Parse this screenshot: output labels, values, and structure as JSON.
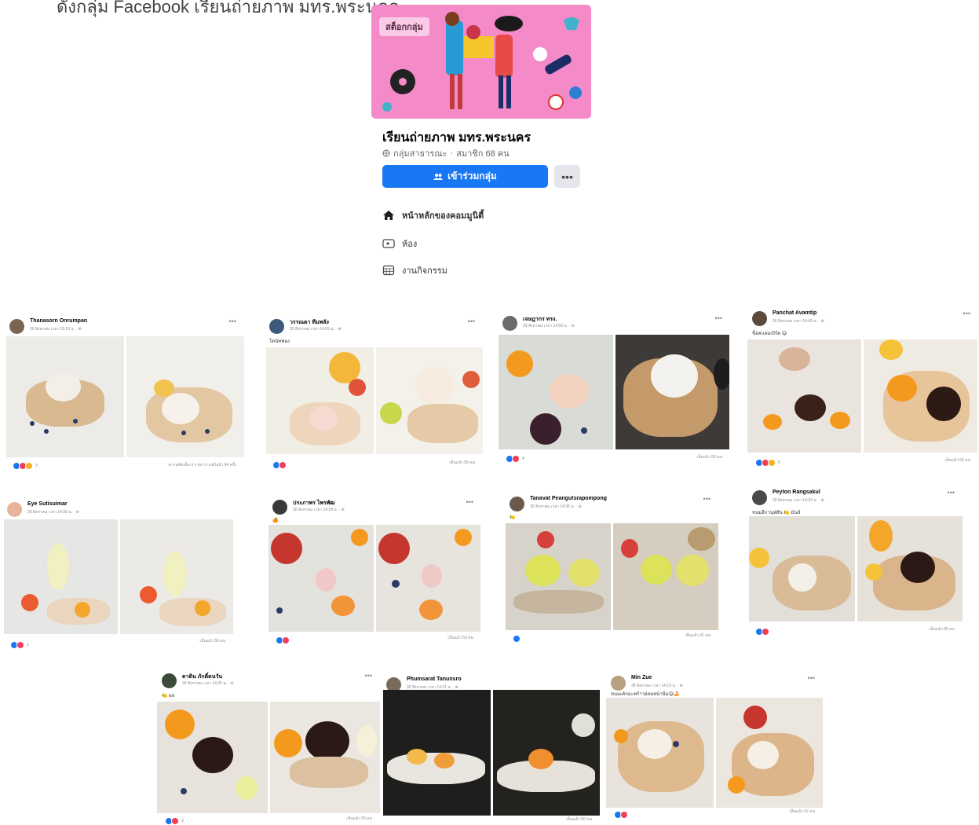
{
  "caption": "ดังกลุ่ม Facebook เรียนถ่ายภาพ มทร.พระนคร",
  "group": {
    "cover_badge": "สต็อกกลุ่ม",
    "title": "เรียนถ่ายภาพ มทร.พระนคร",
    "privacy": "กลุ่มสาธารณะ",
    "members": "สมาชิก 68 คน",
    "join_label": "เข้าร่วมกลุ่ม",
    "more_label": "•••",
    "nav": [
      {
        "label": "หน้าหลักของคอมมูนิตี้",
        "icon": "home-icon"
      },
      {
        "label": "ห้อง",
        "icon": "rooms-icon"
      },
      {
        "label": "งานกิจกรรม",
        "icon": "calendar-icon"
      }
    ]
  },
  "colors": {
    "accent": "#1877f2",
    "cover": "#f07cc0",
    "like": "#1877f2",
    "love": "#f33e58",
    "haha": "#f7b125"
  },
  "posts": [
    {
      "name": "Thanasorn Onrumpan",
      "date": "30 สิงหาคม เวลา 15:16 น. · ⊕",
      "caption": "",
      "reactions": "3",
      "shares": "ความคิดเห็น 4 รายการ  แชร์แล้ว 54 ครั้ง"
    },
    {
      "name": "วรรณดา ทีมพลัง",
      "date": "30 สิงหาคม เวลา 14:59 น. · ⊕",
      "caption": "โดนัทฟอง",
      "reactions": "",
      "shares": "เห็นแล้ว 55 คน"
    },
    {
      "name": "เจษฎากร ทรง.",
      "date": "30 สิงหาคม เวลา 14:50 น. · ⊕",
      "caption": "",
      "reactions": "4",
      "shares": "เห็นแล้ว 53 คน"
    },
    {
      "name": "Panchat Avamtip",
      "date": "30 สิงหาคม เวลา 14:49 น. · ⊕",
      "caption": "ช็อคแลมเบิร์ต 😋",
      "reactions": "5",
      "shares": "เห็นแล้ว 55 คน"
    },
    {
      "name": "Eye Sutisuimar",
      "date": "30 สิงหาคม เวลา 14:39 น. · ⊕",
      "caption": "",
      "reactions": "2",
      "shares": "เห็นแล้ว 50 คน"
    },
    {
      "name": "ประภาพร ไพรพัฒ",
      "date": "30 สิงหาคม เวลา 14:39 น. · ⊕",
      "caption": "🍊",
      "reactions": "",
      "shares": "เห็นแล้ว 53 คน"
    },
    {
      "name": "Tanavat Peangutsrapompong",
      "date": "30 สิงหาคม เวลา 14:35 น. · ⊕",
      "caption": "🍋",
      "reactions": "",
      "shares": "เห็นแล้ว 47 คน"
    },
    {
      "name": "Peyton Rangsakul",
      "date": "30 สิงหาคม เวลา 14:33 น. · ⊕",
      "caption": "ขนมอีกานุฬสัน 🍋 มันส์",
      "reactions": "",
      "shares": "เห็นแล้ว 56 คน"
    },
    {
      "name": "ดาดิน ภักดิ์ดนวัน",
      "date": "30 สิงหาคม เวลา 14:25 น. · ⊕",
      "caption": "🍋 ผล",
      "reactions": "3",
      "shares": "เห็นแล้ว 50 คน"
    },
    {
      "name": "Phumsarat Tanunsro",
      "date": "30 สิงหาคม เวลา 14:21 น. · ⊕",
      "caption": "",
      "reactions": "",
      "shares": "เห็นแล้ว 50 คน"
    },
    {
      "name": "Min Zue",
      "date": "30 สิงหาคม เวลา 14:19 น. · ⊕",
      "caption": "ขนมเค้กมะพร้าวอ่อนหน้านิ่ม😋🍰",
      "reactions": "",
      "shares": "เห็นแล้ว 52 คน"
    }
  ]
}
